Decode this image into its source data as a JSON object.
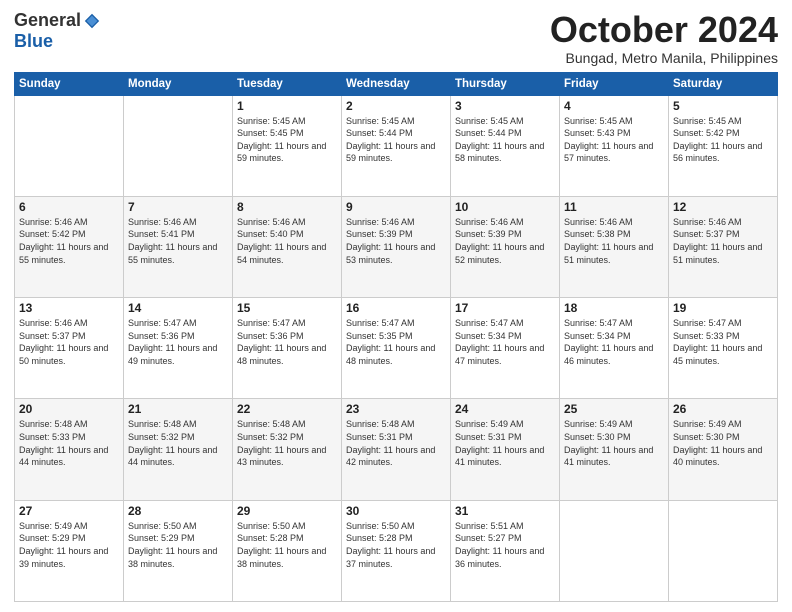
{
  "header": {
    "logo_general": "General",
    "logo_blue": "Blue",
    "month": "October 2024",
    "location": "Bungad, Metro Manila, Philippines"
  },
  "weekdays": [
    "Sunday",
    "Monday",
    "Tuesday",
    "Wednesday",
    "Thursday",
    "Friday",
    "Saturday"
  ],
  "weeks": [
    [
      {
        "day": "",
        "info": ""
      },
      {
        "day": "",
        "info": ""
      },
      {
        "day": "1",
        "info": "Sunrise: 5:45 AM\nSunset: 5:45 PM\nDaylight: 11 hours and 59 minutes."
      },
      {
        "day": "2",
        "info": "Sunrise: 5:45 AM\nSunset: 5:44 PM\nDaylight: 11 hours and 59 minutes."
      },
      {
        "day": "3",
        "info": "Sunrise: 5:45 AM\nSunset: 5:44 PM\nDaylight: 11 hours and 58 minutes."
      },
      {
        "day": "4",
        "info": "Sunrise: 5:45 AM\nSunset: 5:43 PM\nDaylight: 11 hours and 57 minutes."
      },
      {
        "day": "5",
        "info": "Sunrise: 5:45 AM\nSunset: 5:42 PM\nDaylight: 11 hours and 56 minutes."
      }
    ],
    [
      {
        "day": "6",
        "info": "Sunrise: 5:46 AM\nSunset: 5:42 PM\nDaylight: 11 hours and 55 minutes."
      },
      {
        "day": "7",
        "info": "Sunrise: 5:46 AM\nSunset: 5:41 PM\nDaylight: 11 hours and 55 minutes."
      },
      {
        "day": "8",
        "info": "Sunrise: 5:46 AM\nSunset: 5:40 PM\nDaylight: 11 hours and 54 minutes."
      },
      {
        "day": "9",
        "info": "Sunrise: 5:46 AM\nSunset: 5:39 PM\nDaylight: 11 hours and 53 minutes."
      },
      {
        "day": "10",
        "info": "Sunrise: 5:46 AM\nSunset: 5:39 PM\nDaylight: 11 hours and 52 minutes."
      },
      {
        "day": "11",
        "info": "Sunrise: 5:46 AM\nSunset: 5:38 PM\nDaylight: 11 hours and 51 minutes."
      },
      {
        "day": "12",
        "info": "Sunrise: 5:46 AM\nSunset: 5:37 PM\nDaylight: 11 hours and 51 minutes."
      }
    ],
    [
      {
        "day": "13",
        "info": "Sunrise: 5:46 AM\nSunset: 5:37 PM\nDaylight: 11 hours and 50 minutes."
      },
      {
        "day": "14",
        "info": "Sunrise: 5:47 AM\nSunset: 5:36 PM\nDaylight: 11 hours and 49 minutes."
      },
      {
        "day": "15",
        "info": "Sunrise: 5:47 AM\nSunset: 5:36 PM\nDaylight: 11 hours and 48 minutes."
      },
      {
        "day": "16",
        "info": "Sunrise: 5:47 AM\nSunset: 5:35 PM\nDaylight: 11 hours and 48 minutes."
      },
      {
        "day": "17",
        "info": "Sunrise: 5:47 AM\nSunset: 5:34 PM\nDaylight: 11 hours and 47 minutes."
      },
      {
        "day": "18",
        "info": "Sunrise: 5:47 AM\nSunset: 5:34 PM\nDaylight: 11 hours and 46 minutes."
      },
      {
        "day": "19",
        "info": "Sunrise: 5:47 AM\nSunset: 5:33 PM\nDaylight: 11 hours and 45 minutes."
      }
    ],
    [
      {
        "day": "20",
        "info": "Sunrise: 5:48 AM\nSunset: 5:33 PM\nDaylight: 11 hours and 44 minutes."
      },
      {
        "day": "21",
        "info": "Sunrise: 5:48 AM\nSunset: 5:32 PM\nDaylight: 11 hours and 44 minutes."
      },
      {
        "day": "22",
        "info": "Sunrise: 5:48 AM\nSunset: 5:32 PM\nDaylight: 11 hours and 43 minutes."
      },
      {
        "day": "23",
        "info": "Sunrise: 5:48 AM\nSunset: 5:31 PM\nDaylight: 11 hours and 42 minutes."
      },
      {
        "day": "24",
        "info": "Sunrise: 5:49 AM\nSunset: 5:31 PM\nDaylight: 11 hours and 41 minutes."
      },
      {
        "day": "25",
        "info": "Sunrise: 5:49 AM\nSunset: 5:30 PM\nDaylight: 11 hours and 41 minutes."
      },
      {
        "day": "26",
        "info": "Sunrise: 5:49 AM\nSunset: 5:30 PM\nDaylight: 11 hours and 40 minutes."
      }
    ],
    [
      {
        "day": "27",
        "info": "Sunrise: 5:49 AM\nSunset: 5:29 PM\nDaylight: 11 hours and 39 minutes."
      },
      {
        "day": "28",
        "info": "Sunrise: 5:50 AM\nSunset: 5:29 PM\nDaylight: 11 hours and 38 minutes."
      },
      {
        "day": "29",
        "info": "Sunrise: 5:50 AM\nSunset: 5:28 PM\nDaylight: 11 hours and 38 minutes."
      },
      {
        "day": "30",
        "info": "Sunrise: 5:50 AM\nSunset: 5:28 PM\nDaylight: 11 hours and 37 minutes."
      },
      {
        "day": "31",
        "info": "Sunrise: 5:51 AM\nSunset: 5:27 PM\nDaylight: 11 hours and 36 minutes."
      },
      {
        "day": "",
        "info": ""
      },
      {
        "day": "",
        "info": ""
      }
    ]
  ]
}
